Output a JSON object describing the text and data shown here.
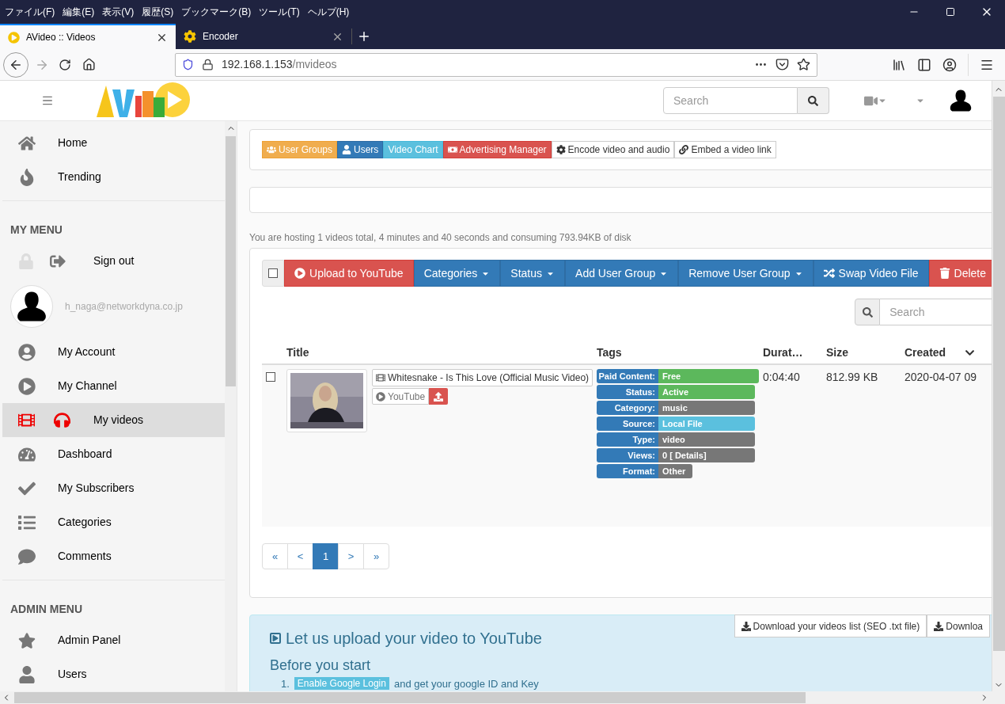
{
  "menu_bar": [
    "ファイル(F)",
    "編集(E)",
    "表示(V)",
    "履歴(S)",
    "ブックマーク(B)",
    "ツール(T)",
    "ヘルプ(H)"
  ],
  "tabs": [
    {
      "title": "AVideo :: Videos",
      "selected": true
    },
    {
      "title": "Encoder",
      "selected": false
    }
  ],
  "address": {
    "host": "192.168.1.153",
    "path": "/mvideos"
  },
  "header": {
    "search": {
      "placeholder": "Search"
    }
  },
  "sidebar": [
    {
      "kind": "link",
      "label": "Home",
      "selected": false
    },
    {
      "kind": "link",
      "label": "Trending",
      "selected": false
    },
    {
      "kind": "heading",
      "label": "MY MENU"
    },
    {
      "kind": "link",
      "label": "Sign out",
      "selected": false
    },
    {
      "kind": "user",
      "label": "h_naga@networkdyna.co.jp"
    },
    {
      "kind": "link",
      "label": "My Account",
      "selected": false
    },
    {
      "kind": "link",
      "label": "My Channel",
      "selected": false
    },
    {
      "kind": "link",
      "label": "My videos",
      "selected": true
    },
    {
      "kind": "link",
      "label": "Dashboard",
      "selected": false
    },
    {
      "kind": "link",
      "label": "My Subscribers",
      "selected": false
    },
    {
      "kind": "link",
      "label": "Categories",
      "selected": false
    },
    {
      "kind": "link",
      "label": "Comments",
      "selected": false
    },
    {
      "kind": "heading",
      "label": "ADMIN MENU"
    },
    {
      "kind": "link",
      "label": "Admin Panel",
      "selected": false
    },
    {
      "kind": "link",
      "label": "Users",
      "selected": false
    }
  ],
  "top_buttons": [
    {
      "label": "User Groups",
      "kind": "warning"
    },
    {
      "label": "Users",
      "kind": "primary"
    },
    {
      "label": "Video Chart",
      "kind": "info"
    },
    {
      "label": "Advertising Manager",
      "kind": "danger"
    },
    {
      "label": "Encode video and audio",
      "kind": "default"
    },
    {
      "label": "Embed a video link",
      "kind": "default"
    }
  ],
  "summary": "You are hosting 1 videos total, 4 minutes and 40 seconds and consuming 793.94KB of disk",
  "bulk_actions": {
    "select_all": false,
    "buttons": [
      {
        "label": "Upload to YouTube",
        "kind": "danger",
        "dropdown": false
      },
      {
        "label": "Categories",
        "kind": "primary",
        "dropdown": true
      },
      {
        "label": "Status",
        "kind": "primary",
        "dropdown": true
      },
      {
        "label": "Add User Group",
        "kind": "primary",
        "dropdown": true
      },
      {
        "label": "Remove User Group",
        "kind": "primary",
        "dropdown": true
      },
      {
        "label": "Swap Video File",
        "kind": "primary",
        "dropdown": false
      },
      {
        "label": "Delete",
        "kind": "danger",
        "dropdown": false
      }
    ]
  },
  "table": {
    "search": {
      "placeholder": "Search"
    },
    "columns": [
      "Title",
      "Tags",
      "Durat…",
      "Size",
      "Created"
    ],
    "rows": [
      {
        "checked": false,
        "title": "Whitesnake - Is This Love (Official Music Video)",
        "source_label": "YouTube",
        "tags": [
          {
            "name": "Paid Content:",
            "value": "Free",
            "color": "#5cb85c"
          },
          {
            "name": "Status:",
            "value": "Active",
            "color": "#5cb85c"
          },
          {
            "name": "Category:",
            "value": "music",
            "color": "#777777"
          },
          {
            "name": "Source:",
            "value": "Local File",
            "color": "#5bc0de"
          },
          {
            "name": "Type:",
            "value": "video",
            "color": "#777777"
          },
          {
            "name": "Views:",
            "value": "0 [ Details]",
            "color": "#777777"
          },
          {
            "name": "Format:",
            "value": "Other",
            "color": "#777777"
          }
        ],
        "duration": "0:04:40",
        "size": "812.99 KB",
        "created": "2020-04-07 09"
      }
    ]
  },
  "pagination": [
    {
      "label": "«",
      "selected": false
    },
    {
      "label": "<",
      "selected": false
    },
    {
      "label": "1",
      "selected": true
    },
    {
      "label": ">",
      "selected": false
    },
    {
      "label": "»",
      "selected": false
    }
  ],
  "downloads": [
    "Download your videos list (SEO .txt file)",
    "Downloa"
  ],
  "youtube_panel": {
    "title": "Let us upload your video to YouTube",
    "subtitle": "Before you start",
    "step_number": "1.",
    "step_button": "Enable Google Login",
    "step_text": "and get your google ID and Key"
  }
}
